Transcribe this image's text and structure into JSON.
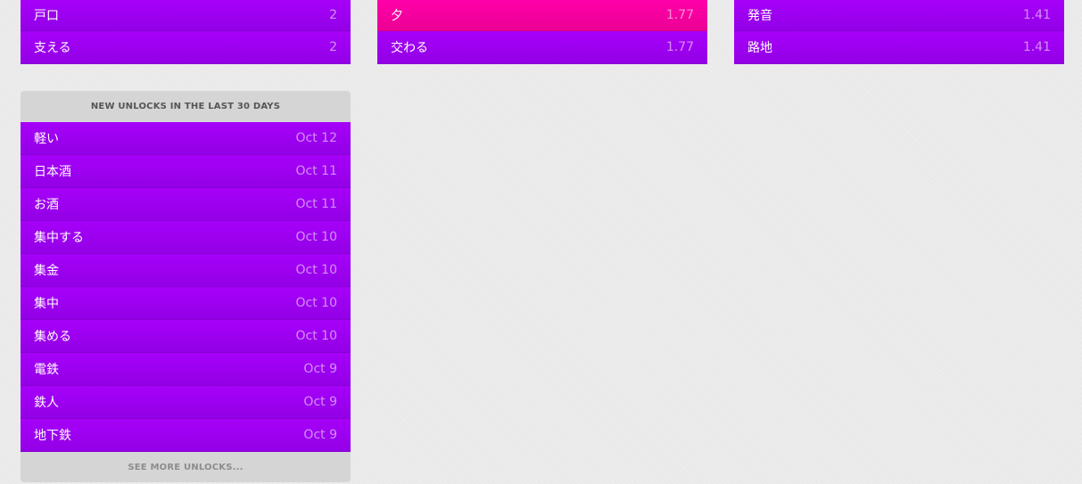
{
  "colors": {
    "item_purple": "#a100f2",
    "item_pink": "#f7009e",
    "panel_gray": "#d5d5d5",
    "background": "#ececec"
  },
  "left_top": [
    {
      "label": "戸口",
      "value": "2"
    },
    {
      "label": "支える",
      "value": "2"
    }
  ],
  "mid_top": [
    {
      "label": "夕",
      "value": "1.77"
    },
    {
      "label": "交わる",
      "value": "1.77"
    }
  ],
  "right_top": [
    {
      "label": "発音",
      "value": "1.41"
    },
    {
      "label": "路地",
      "value": "1.41"
    }
  ],
  "unlocks": {
    "header": "NEW UNLOCKS IN THE LAST 30 DAYS",
    "items": [
      {
        "label": "軽い",
        "date": "Oct 12"
      },
      {
        "label": "日本酒",
        "date": "Oct 11"
      },
      {
        "label": "お酒",
        "date": "Oct 11"
      },
      {
        "label": "集中する",
        "date": "Oct 10"
      },
      {
        "label": "集金",
        "date": "Oct 10"
      },
      {
        "label": "集中",
        "date": "Oct 10"
      },
      {
        "label": "集める",
        "date": "Oct 10"
      },
      {
        "label": "電鉄",
        "date": "Oct 9"
      },
      {
        "label": "鉄人",
        "date": "Oct 9"
      },
      {
        "label": "地下鉄",
        "date": "Oct 9"
      }
    ],
    "footer": "SEE MORE UNLOCKS..."
  }
}
